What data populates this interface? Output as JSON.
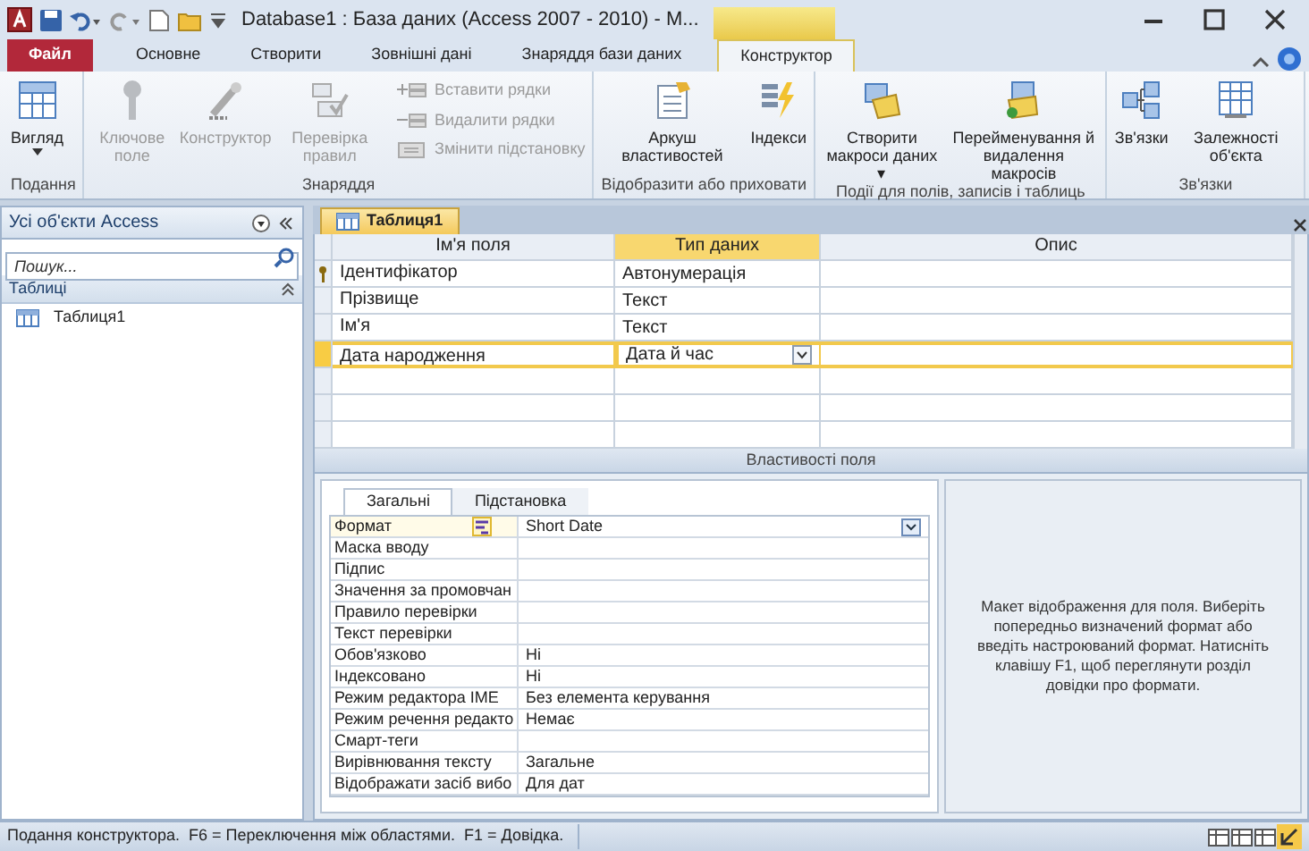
{
  "window": {
    "title": "Database1 : База даних (Access 2007 - 2010) - M..."
  },
  "ribbon": {
    "tabs": [
      {
        "label": "Файл",
        "kind": "file",
        "selected": false
      },
      {
        "label": "Основне",
        "kind": "normal",
        "selected": false
      },
      {
        "label": "Створити",
        "kind": "normal",
        "selected": false
      },
      {
        "label": "Зовнішні дані",
        "kind": "normal",
        "selected": false
      },
      {
        "label": "Знаряддя бази даних",
        "kind": "normal",
        "selected": false
      },
      {
        "label": "Конструктор",
        "kind": "contextual",
        "selected": true
      }
    ],
    "groups": [
      {
        "label": "Подання",
        "buttons": [
          {
            "label": "Вигляд",
            "kind": "dropdown",
            "disabled": false
          }
        ]
      },
      {
        "label": "Знаряддя",
        "buttons": [
          {
            "label": "Ключове поле",
            "kind": "large",
            "disabled": true
          },
          {
            "label": "Конструктор",
            "kind": "large",
            "disabled": true
          },
          {
            "label": "Перевірка правил",
            "kind": "large",
            "disabled": true
          },
          {
            "label": "Вставити рядки",
            "kind": "small",
            "disabled": true
          },
          {
            "label": "Видалити рядки",
            "kind": "small",
            "disabled": true
          },
          {
            "label": "Змінити підстановку",
            "kind": "small",
            "disabled": true
          }
        ]
      },
      {
        "label": "Відобразити або приховати",
        "buttons": [
          {
            "label": "Аркуш властивостей",
            "kind": "large",
            "disabled": false
          },
          {
            "label": "Індекси",
            "kind": "large",
            "disabled": false
          }
        ]
      },
      {
        "label": "Події для полів, записів і таблиць",
        "buttons": [
          {
            "label": "Створити макроси даних ▾",
            "kind": "large",
            "disabled": false
          },
          {
            "label": "Перейменування й видалення макросів",
            "kind": "large",
            "disabled": false
          }
        ]
      },
      {
        "label": "Зв'язки",
        "buttons": [
          {
            "label": "Зв'язки",
            "kind": "large",
            "disabled": false
          },
          {
            "label": "Залежності об'єкта",
            "kind": "large",
            "disabled": false
          }
        ]
      }
    ]
  },
  "navigation_pane": {
    "title": "Усі об'єкти Access",
    "search": {
      "placeholder": "Пошук..."
    },
    "group": "Таблиці",
    "items": [
      {
        "label": "Таблиця1",
        "selected": false
      }
    ]
  },
  "document_tab": {
    "label": "Таблиця1"
  },
  "design_grid": {
    "columns": [
      "Ім'я поля",
      "Тип даних",
      "Опис"
    ],
    "rows": [
      {
        "field_name": "Ідентифікатор",
        "data_type": "Автонумерація",
        "primary_key": true,
        "selected": false
      },
      {
        "field_name": "Прізвище",
        "data_type": "Текст",
        "primary_key": false,
        "selected": false
      },
      {
        "field_name": "Ім'я",
        "data_type": "Текст",
        "primary_key": false,
        "selected": false
      },
      {
        "field_name": "Дата народження",
        "data_type": "Дата й час",
        "primary_key": false,
        "selected": true
      }
    ]
  },
  "field_properties": {
    "title": "Властивості поля",
    "tabs": [
      {
        "label": "Загальні",
        "selected": true
      },
      {
        "label": "Підстановка",
        "selected": false
      }
    ],
    "rows": [
      {
        "label": "Формат",
        "value": "Short Date",
        "selected": true
      },
      {
        "label": "Маска вводу",
        "selected": false
      },
      {
        "label": "Підпис",
        "selected": false
      },
      {
        "label": "Значення за промовчан",
        "selected": false
      },
      {
        "label": "Правило перевірки",
        "selected": false
      },
      {
        "label": "Текст перевірки",
        "selected": false
      },
      {
        "label": "Обов'язково",
        "value": "Ні",
        "selected": false
      },
      {
        "label": "Індексовано",
        "value": "Ні",
        "selected": false
      },
      {
        "label": "Режим редактора IME",
        "value": "Без елемента керування",
        "selected": false
      },
      {
        "label": "Режим речення редакто",
        "value": "Немає",
        "selected": false
      },
      {
        "label": "Смарт-теги",
        "selected": false
      },
      {
        "label": "Вирівнювання тексту",
        "value": "Загальне",
        "selected": false
      },
      {
        "label": "Відображати засіб вибо",
        "value": "Для дат",
        "selected": false
      }
    ],
    "help": "Макет відображення для поля. Виберіть попередньо визначений формат або введіть настроюваний формат. Натисніть клавішу F1, щоб переглянути розділ довідки про формати."
  },
  "status_bar": {
    "text": "Подання конструктора.  F6 = Переключення між областями.  F1 = Довідка."
  }
}
